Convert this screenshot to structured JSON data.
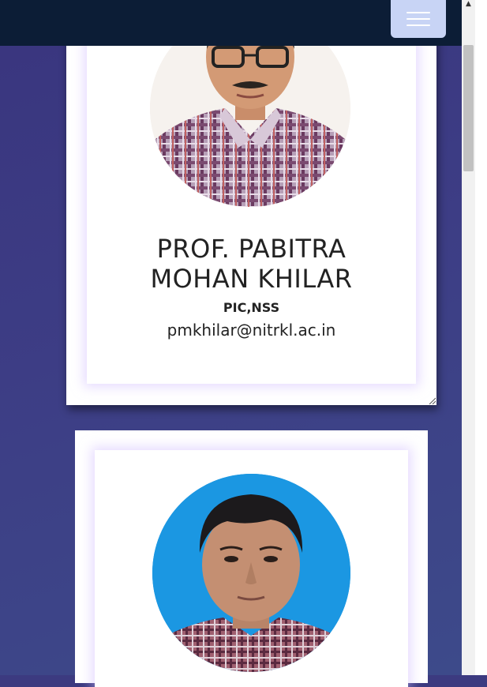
{
  "navbar": {
    "toggler_label": "Toggle navigation"
  },
  "profiles": [
    {
      "name_line1": "PROF. PABITRA",
      "name_line2": "MOHAN KHILAR",
      "role": "PIC,NSS",
      "email": "pmkhilar@nitrkl.ac.in"
    },
    {
      "name_line1": "",
      "name_line2": "",
      "role": "",
      "email": ""
    }
  ],
  "colors": {
    "navbar_bg": "#0c1d36",
    "page_bg": "#3c3a80",
    "toggler_bg": "#c8d4f5",
    "card_bg": "#ffffff"
  }
}
